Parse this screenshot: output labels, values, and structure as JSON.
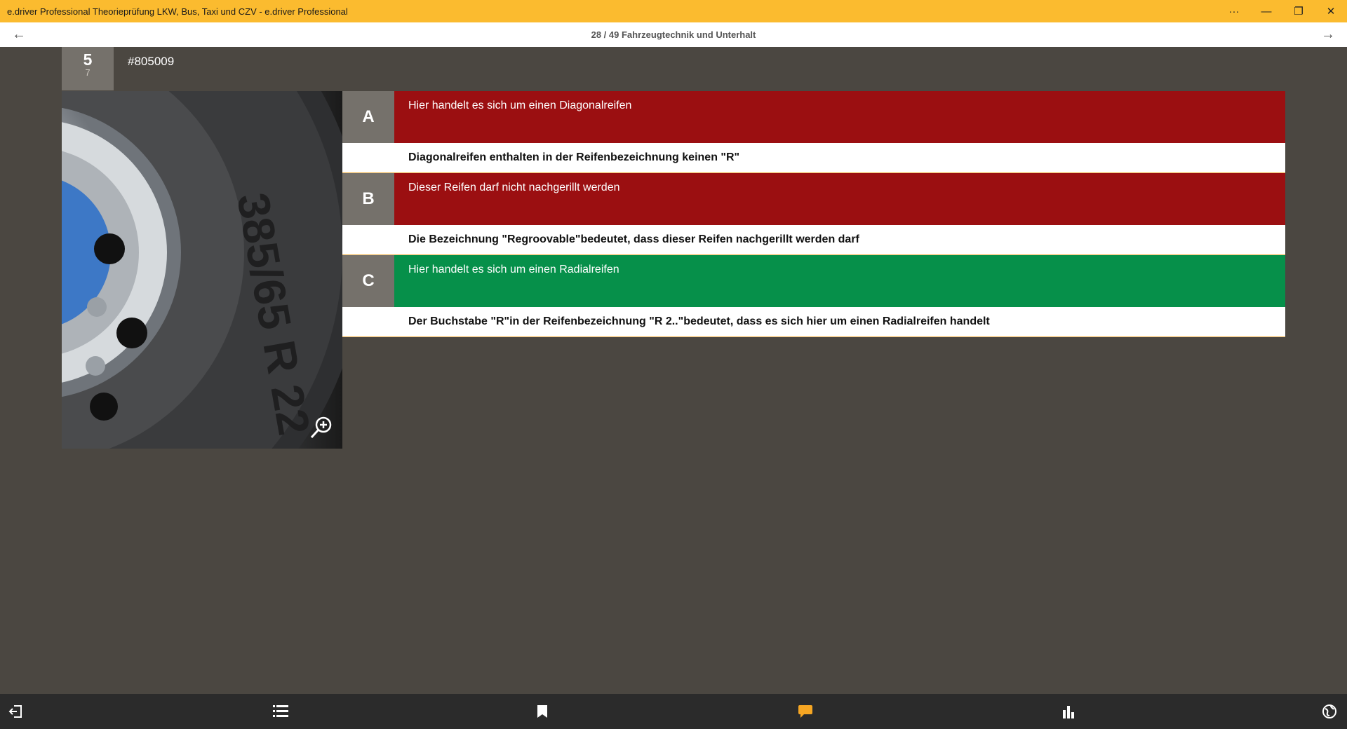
{
  "window": {
    "title": "e.driver Professional Theorieprüfung LKW, Bus, Taxi und CZV - e.driver Professional",
    "more_label": "···",
    "minimize_label": "—",
    "restore_label": "❐",
    "close_label": "✕"
  },
  "nav": {
    "back_icon": "←",
    "forward_icon": "→",
    "title": "28 / 49 Fahrzeugtechnik und Unterhalt"
  },
  "question": {
    "points": "5",
    "points_sub": "7",
    "id": "#805009"
  },
  "answers": [
    {
      "letter": "A",
      "text": "Hier handelt es sich um einen Diagonalreifen",
      "explanation": "Diagonalreifen enthalten in der Reifenbezeichnung keinen \"R\"",
      "status_color": "#9b0f11"
    },
    {
      "letter": "B",
      "text": "Dieser Reifen darf nicht nachgerillt werden",
      "explanation": "Die Bezeichnung \"Regroovable\"bedeutet, dass dieser Reifen nachgerillt werden darf",
      "status_color": "#9b0f11"
    },
    {
      "letter": "C",
      "text": "Hier handelt es sich um einen Radialreifen",
      "explanation": "Der Buchstabe \"R\"in der Reifenbezeichnung \"R 2..\"bedeutet, dass es sich hier um einen Radialreifen handelt",
      "status_color": "#06904a"
    }
  ],
  "image": {
    "tire_marking": "385/65 R 22"
  },
  "bottom_bar": {
    "icons": [
      "exit-icon",
      "list-icon",
      "bookmark-icon",
      "comment-icon",
      "stats-icon",
      "globe-icon"
    ],
    "comment_color": "#f6a623"
  },
  "colors": {
    "accent": "#fbbb2f",
    "background": "#4b4741",
    "badge": "#75716b",
    "wrong": "#9b0f11",
    "correct": "#06904a"
  }
}
